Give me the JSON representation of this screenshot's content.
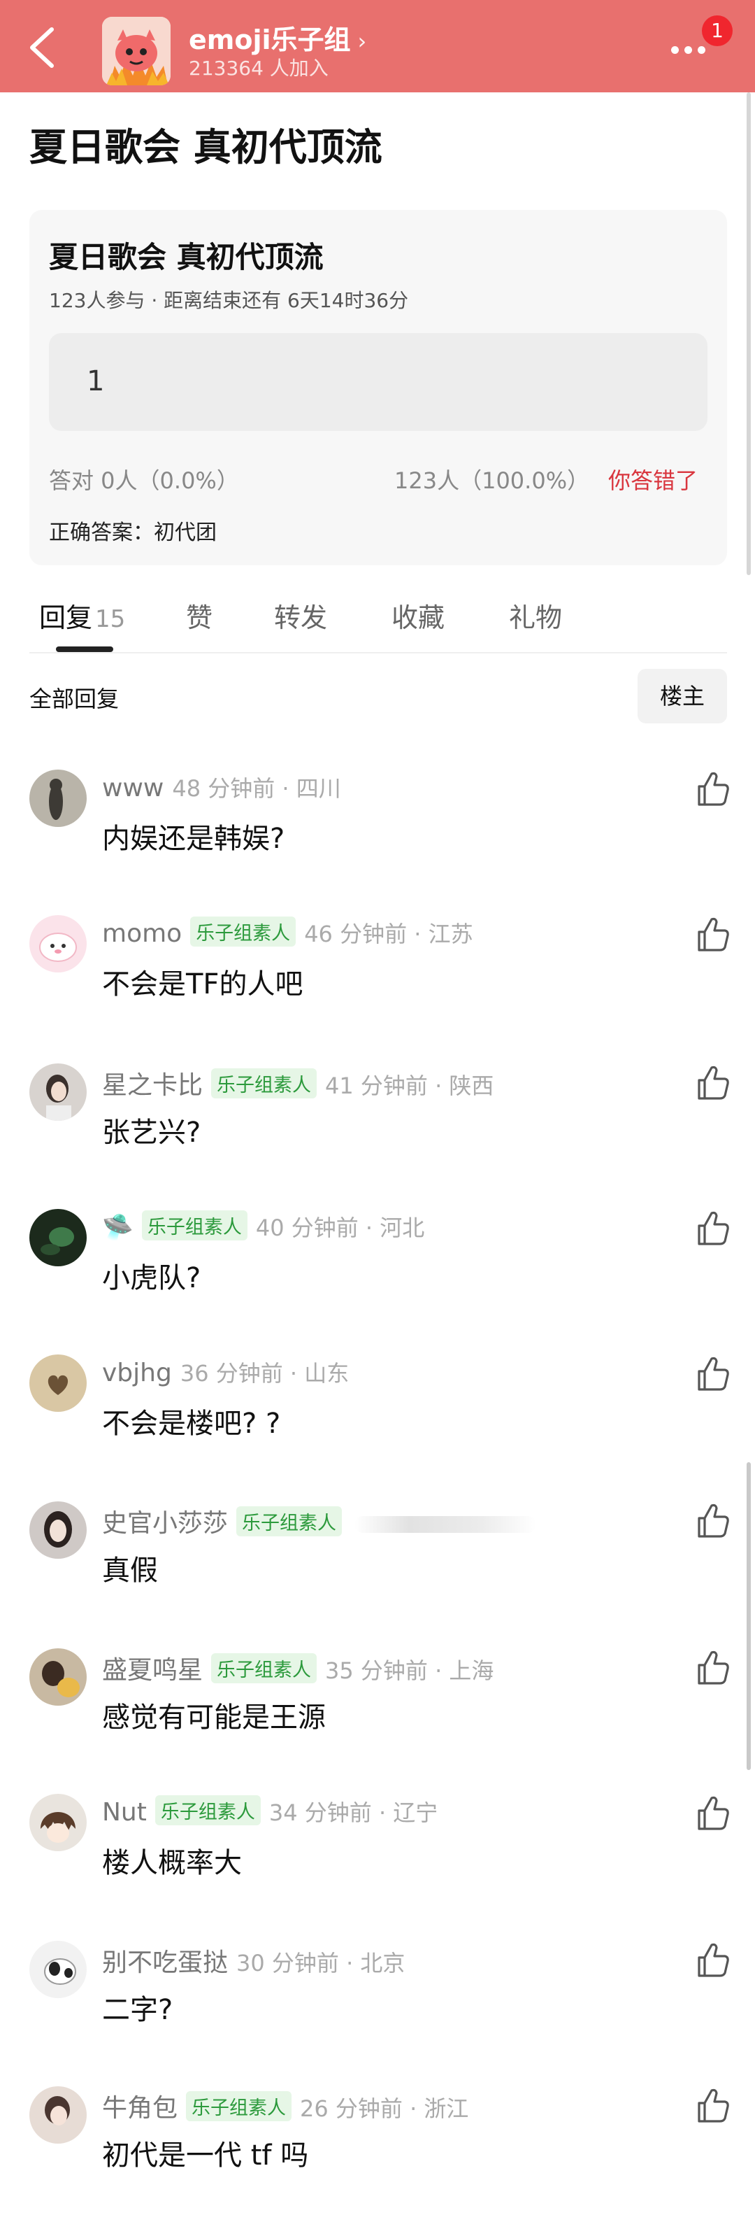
{
  "header": {
    "group_name": "emoji乐子组",
    "chevron": "›",
    "members": "213364 人加入",
    "notification_count": "1",
    "bg_color": "#e8706e"
  },
  "post": {
    "title": "夏日歌会 真初代顶流"
  },
  "poll": {
    "title": "夏日歌会 真初代顶流",
    "meta": "123人参与 · 距离结束还有 6天14时36分",
    "option_text": "1",
    "correct_stat": "答对  0人（0.0%）",
    "wrong_stat": "123人（100.0%）",
    "result_label": "你答错了",
    "answer": "正确答案：初代团"
  },
  "tabs": [
    {
      "label": "回复",
      "count": "15"
    },
    {
      "label": "赞"
    },
    {
      "label": "转发"
    },
    {
      "label": "收藏"
    },
    {
      "label": "礼物"
    }
  ],
  "replies": {
    "section_label": "全部回复",
    "filter_label": "楼主"
  },
  "comments": [
    {
      "name": "www",
      "time": "48 分钟前 · 四川",
      "text": "内娱还是韩娱?"
    },
    {
      "name": "momo",
      "tag": "乐子组素人",
      "time": "46 分钟前 · 江苏",
      "text": "不会是TF的人吧"
    },
    {
      "name": "星之卡比",
      "tag": "乐子组素人",
      "time": "41 分钟前 · 陕西",
      "text": "张艺兴?"
    },
    {
      "name": "🛸",
      "tag": "乐子组素人",
      "time": "40 分钟前 · 河北",
      "text": "小虎队?"
    },
    {
      "name": "vbjhg",
      "time": "36 分钟前 · 山东",
      "text": "不会是楼吧? ?"
    },
    {
      "name": "史官小莎莎",
      "tag": "乐子组素人",
      "text": "真假"
    },
    {
      "name": "盛夏鸣星",
      "tag": "乐子组素人",
      "time": "35 分钟前 · 上海",
      "text": "感觉有可能是王源"
    },
    {
      "name": "Nut",
      "tag": "乐子组素人",
      "time": "34 分钟前 · 辽宁",
      "text": "楼人概率大"
    },
    {
      "name": "别不吃蛋挞",
      "time": "30 分钟前 · 北京",
      "text": "二字?"
    },
    {
      "name": "牛角包",
      "tag": "乐子组素人",
      "time": "26 分钟前 · 浙江",
      "text": "初代是一代 tf 吗"
    }
  ]
}
